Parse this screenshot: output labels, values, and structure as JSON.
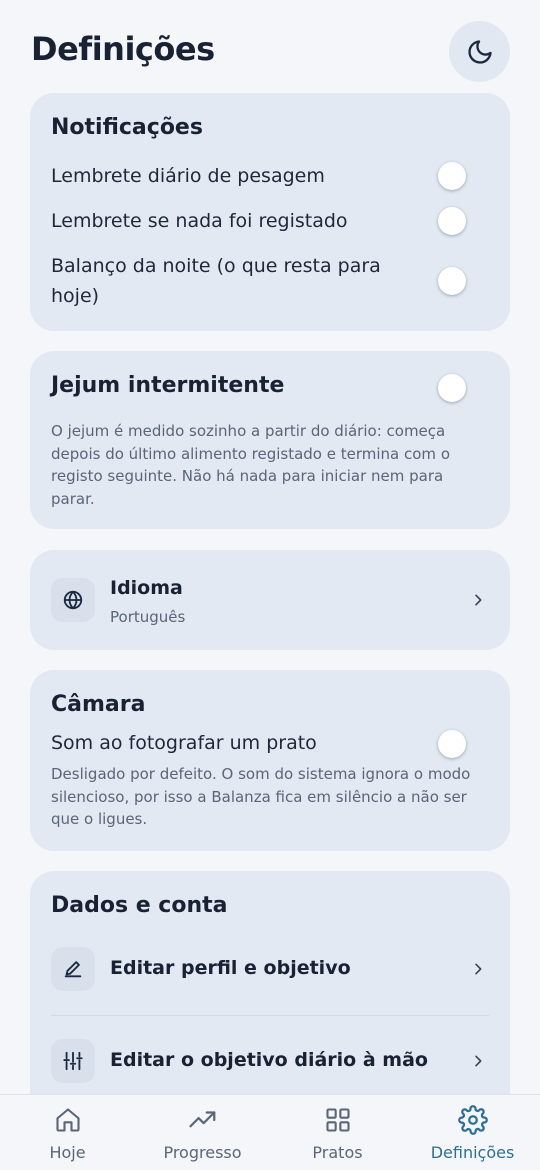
{
  "header": {
    "title": "Definições",
    "theme_icon": "moon-icon"
  },
  "notifications": {
    "title": "Notificações",
    "items": [
      {
        "label": "Lembrete diário de pesagem",
        "enabled": false
      },
      {
        "label": "Lembrete se nada foi registado",
        "enabled": false
      },
      {
        "label_line1": "Balanço da noite (o que resta para",
        "label_line2": "hoje)",
        "enabled": false
      }
    ]
  },
  "fasting": {
    "title": "Jejum intermitente",
    "enabled": false,
    "description": "O jejum é medido sozinho a partir do diário: começa depois do último alimento registado e termina com o registo seguinte. Não há nada para iniciar nem para parar."
  },
  "language": {
    "label": "Idioma",
    "value": "Português",
    "icon": "globe-icon"
  },
  "camera": {
    "title": "Câmara",
    "sound_label": "Som ao fotografar um prato",
    "sound_enabled": false,
    "description": "Desligado por defeito. O som do sistema ignora o modo silencioso, por isso a Balanza fica em silêncio a não ser que o ligues."
  },
  "data_account": {
    "title": "Dados e conta",
    "items": [
      {
        "label": "Editar perfil e objetivo",
        "icon": "pencil-icon"
      },
      {
        "label": "Editar o objetivo diário à mão",
        "icon": "sliders-icon"
      }
    ]
  },
  "tabbar": {
    "tabs": [
      {
        "label": "Hoje",
        "icon": "home-icon",
        "active": false
      },
      {
        "label": "Progresso",
        "icon": "trending-up-icon",
        "active": false
      },
      {
        "label": "Pratos",
        "icon": "grid-icon",
        "active": false
      },
      {
        "label": "Definições",
        "icon": "gear-icon",
        "active": true
      }
    ]
  },
  "colors": {
    "background": "#f4f6fa",
    "card": "#e2e9f2",
    "text": "#182234",
    "muted": "#5a6577",
    "accent": "#2c6f93"
  }
}
